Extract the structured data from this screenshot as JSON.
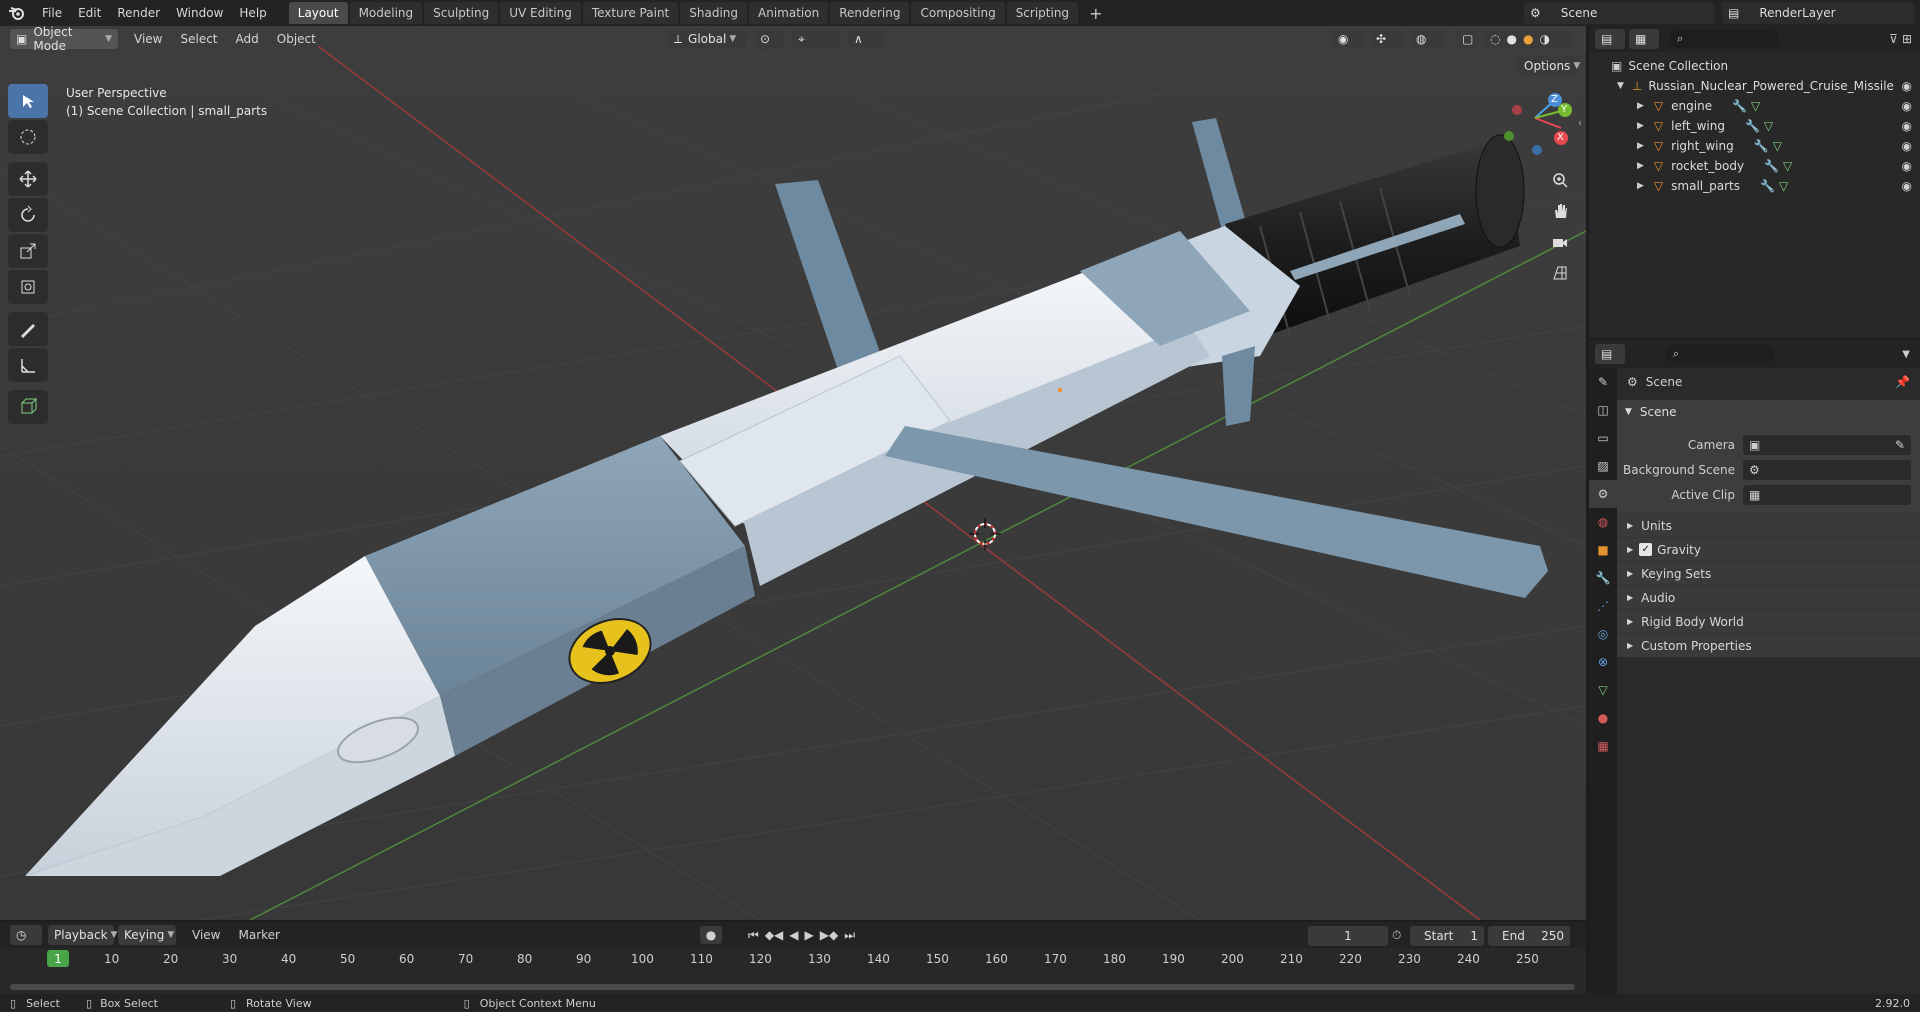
{
  "topbar": {
    "menu": [
      "File",
      "Edit",
      "Render",
      "Window",
      "Help"
    ],
    "workspaces": [
      "Layout",
      "Modeling",
      "Sculpting",
      "UV Editing",
      "Texture Paint",
      "Shading",
      "Animation",
      "Rendering",
      "Compositing",
      "Scripting"
    ],
    "active_workspace": "Layout",
    "add_tab": "+",
    "scene": "Scene",
    "view_layer": "RenderLayer"
  },
  "viewport": {
    "mode": "Object Mode",
    "menu": [
      "View",
      "Select",
      "Add",
      "Object"
    ],
    "transform_orientation": "Global",
    "options": "Options",
    "perspective_label": "User Perspective",
    "collection_label": "(1) Scene Collection | small_parts",
    "gizmo": {
      "x": "X",
      "y": "Y",
      "z": "Z"
    }
  },
  "outliner": {
    "root": "Scene Collection",
    "collection": "Russian_Nuclear_Powered_Cruise_Missile",
    "objects": [
      "engine",
      "left_wing",
      "right_wing",
      "rocket_body",
      "small_parts"
    ]
  },
  "properties": {
    "context": "Scene",
    "panel": "Scene",
    "fields": [
      {
        "label": "Camera",
        "value": ""
      },
      {
        "label": "Background Scene",
        "value": ""
      },
      {
        "label": "Active Clip",
        "value": ""
      }
    ],
    "subpanels": [
      "Units",
      "Gravity",
      "Keying Sets",
      "Audio",
      "Rigid Body World",
      "Custom Properties"
    ],
    "gravity_checked": true
  },
  "timeline": {
    "menu": [
      "Playback",
      "Keying",
      "View",
      "Marker"
    ],
    "current_frame": "1",
    "start_label": "Start",
    "start": "1",
    "end_label": "End",
    "end": "250",
    "ruler": [
      "1",
      "10",
      "20",
      "30",
      "40",
      "50",
      "60",
      "70",
      "80",
      "90",
      "100",
      "110",
      "120",
      "130",
      "140",
      "150",
      "160",
      "170",
      "180",
      "190",
      "200",
      "210",
      "220",
      "230",
      "240",
      "250"
    ]
  },
  "statusbar": {
    "select": "Select",
    "box_select": "Box Select",
    "rotate_view": "Rotate View",
    "context_menu": "Object Context Menu",
    "version": "2.92.0"
  },
  "colors": {
    "accent": "#4b74a9",
    "active_frame": "#47a447",
    "grid_x": "#9a3a3a",
    "grid_y": "#4f8a3a"
  }
}
